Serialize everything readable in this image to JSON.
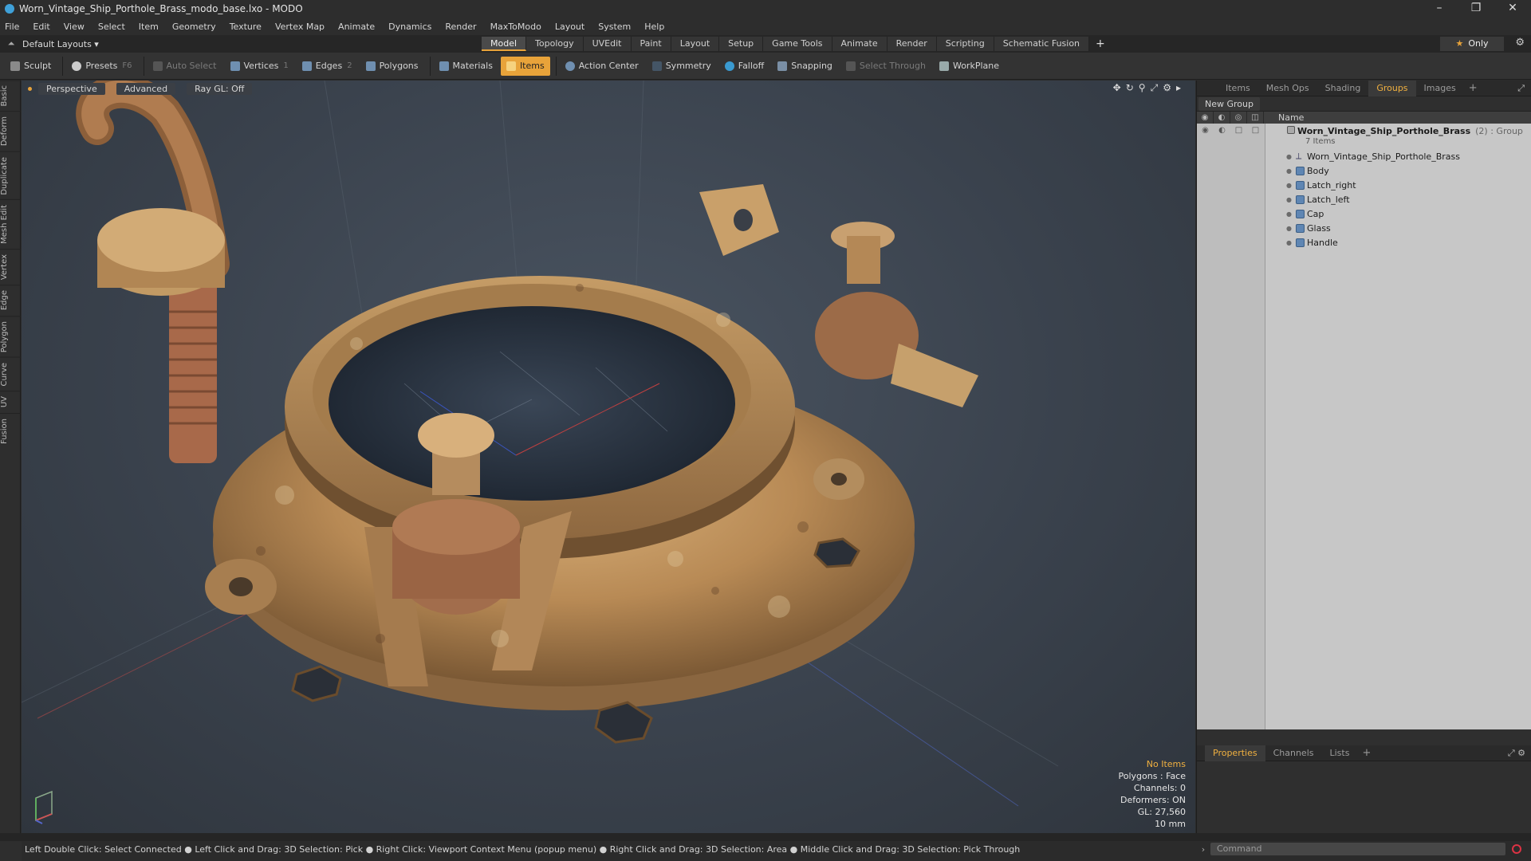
{
  "window": {
    "title": "Worn_Vintage_Ship_Porthole_Brass_modo_base.lxo - MODO",
    "controls": [
      "–",
      "❐",
      "✕"
    ]
  },
  "menu": [
    "File",
    "Edit",
    "View",
    "Select",
    "Item",
    "Geometry",
    "Texture",
    "Vertex Map",
    "Animate",
    "Dynamics",
    "Render",
    "MaxToModo",
    "Layout",
    "System",
    "Help"
  ],
  "layout_bar": {
    "layouts_label": "Default Layouts ▾",
    "tabs": [
      "Model",
      "Topology",
      "UVEdit",
      "Paint",
      "Layout",
      "Setup",
      "Game Tools",
      "Animate",
      "Render",
      "Scripting",
      "Schematic Fusion"
    ],
    "active_tab": "Model",
    "add": "+",
    "only_label": "Only",
    "only_star": "★"
  },
  "toolbar": {
    "sculpt": "Sculpt",
    "presets": "Presets",
    "presets_key": "F6",
    "auto_select": "Auto Select",
    "vertices": "Vertices",
    "vertices_key": "1",
    "edges": "Edges",
    "edges_key": "2",
    "polygons": "Polygons",
    "materials": "Materials",
    "items": "Items",
    "action_center": "Action Center",
    "symmetry": "Symmetry",
    "falloff": "Falloff",
    "snapping": "Snapping",
    "select_through": "Select Through",
    "workplane": "WorkPlane"
  },
  "left_tabs": [
    "Basic",
    "Deform",
    "Duplicate",
    "Mesh Edit",
    "Vertex",
    "Edge",
    "Polygon",
    "Curve",
    "UV",
    "Fusion"
  ],
  "viewport": {
    "view": "Perspective",
    "shading": "Advanced",
    "raygl": "Ray GL: Off",
    "info": {
      "status": "No Items",
      "polygons": "Polygons : Face",
      "channels": "Channels: 0",
      "deformers": "Deformers: ON",
      "gl": "GL: 27,560",
      "unit": "10 mm"
    }
  },
  "groups_panel": {
    "tabs": [
      "Items",
      "Mesh Ops",
      "Shading",
      "Groups",
      "Images"
    ],
    "active_tab": "Groups",
    "new_group": "New Group",
    "name_header": "Name",
    "group": {
      "name": "Worn_Vintage_Ship_Porthole_Brass",
      "count": "(2) : Group",
      "sub": "7 Items"
    },
    "items": [
      "Worn_Vintage_Ship_Porthole_Brass",
      "Body",
      "Latch_right",
      "Latch_left",
      "Cap",
      "Glass",
      "Handle"
    ]
  },
  "props_panel": {
    "tabs": [
      "Properties",
      "Channels",
      "Lists"
    ],
    "active_tab": "Properties"
  },
  "statusbar": {
    "text": "Left Double Click: Select Connected ● Left Click and Drag: 3D Selection: Pick ● Right Click: Viewport Context Menu (popup menu) ● Right Click and Drag: 3D Selection: Area ● Middle Click and Drag: 3D Selection: Pick Through"
  },
  "command": {
    "placeholder": "Command"
  },
  "colors": {
    "accent": "#e8a33a",
    "brass": "#b98a52",
    "viewport_bg": "#3a424d"
  }
}
